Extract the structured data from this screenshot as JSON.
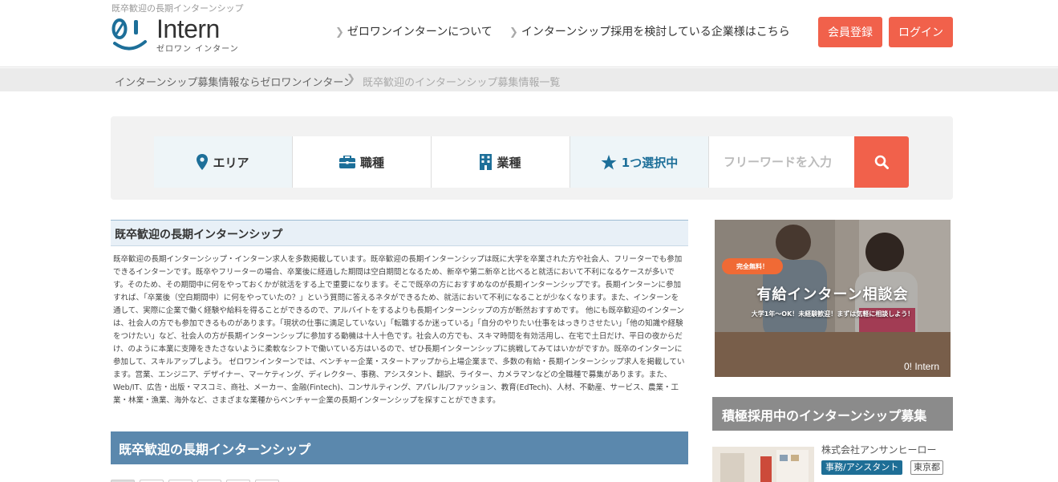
{
  "header": {
    "tagline": "既卒歓迎の長期インターンシップ",
    "logo_text": "Intern",
    "logo_sub": "ゼロワン インターン",
    "nav": [
      {
        "label": "ゼロワンインターンについて"
      },
      {
        "label": "インターンシップ採用を検討している企業様はこちら"
      }
    ],
    "register_label": "会員登録",
    "login_label": "ログイン"
  },
  "breadcrumb": {
    "home": "インターンシップ募集情報ならゼロワンインターン",
    "current": "既卒歓迎のインターンシップ募集情報一覧"
  },
  "search": {
    "area_label": "エリア",
    "job_label": "職種",
    "industry_label": "業種",
    "selected_label": "1つ選択中",
    "freeword_placeholder": "フリーワードを入力"
  },
  "main": {
    "section_title": "既卒歓迎の長期インターンシップ",
    "intro": "既卒歓迎の長期インターンシップ・インターン求人を多数掲載しています。既卒歓迎の長期インターンシップは既に大学を卒業された方や社会人、フリーターでも参加できるインターンです。既卒やフリーターの場合、卒業後に経過した期間は空白期間となるため、新卒や第二新卒と比べると就活において不利になるケースが多いです。そのため、その期間中に何をやっておくかが就活をする上で重要になります。そこで既卒の方におすすめなのが長期インターンシップです。長期インターンに参加すれば、「卒業後（空白期間中）に何をやっていたの？」という質問に答えるネタができるため、就活において不利になることが少なくなります。また、インターンを通して、実際に企業で働く経験や給料を得ることができるので、アルバイトをするよりも長期インターンシップの方が断然おすすめです。 他にも既卒歓迎のインターンは、社会人の方でも参加できるものがあります。「現状の仕事に満足していない」「転職するか迷っている」「自分のやりたい仕事をはっきりさせたい」「他の知識や経験をつけたい」など、社会人の方が長期インターンシップに参加する動機は十人十色です。社会人の方でも、スキマ時間を有効活用し、在宅で土日だけ、平日の夜からだけ、のように本業に支障をきたさないように柔軟なシフトで働いている方はいるので、ぜひ長期インターンシップに挑戦してみてはいかがですか。既卒のインターンに参加して、スキルアップしよう。 ゼロワンインターンでは、ベンチャー企業・スタートアップから上場企業まで、多数の有給・長期インターンシップ求人を掲載しています。営業、エンジニア、デザイナー、マーケティング、ディレクター、事務、アシスタント、翻訳、ライター、カメラマンなどの全職種で募集があります。また、Web/IT、広告・出版・マスコミ、商社、メーカー、金融(Fintech)、コンサルティング、アパレル/ファッション、教育(EdTech)、人材、不動産、サービス、農業・工業・林業・漁業、海外など、さまざまな業種からベンチャー企業の長期インターンシップを探すことができます。",
    "list_title": "既卒歓迎の長期インターンシップ"
  },
  "sidebar": {
    "banner": {
      "badge": "完全無料！",
      "title": "有給インターン相談会",
      "subtitle": "大学1年〜OK！未経験歓迎！まずは気軽に相談しよう！",
      "logo": "0! Intern"
    },
    "recruit_title": "積極採用中のインターンシップ募集",
    "card": {
      "company": "株式会社アンサンヒーロー",
      "tag": "事務/アシスタント",
      "location": "東京都"
    }
  },
  "colors": {
    "accent_red": "#f1614b",
    "accent_blue": "#1e6e96",
    "section_bar": "#5b88ad"
  }
}
